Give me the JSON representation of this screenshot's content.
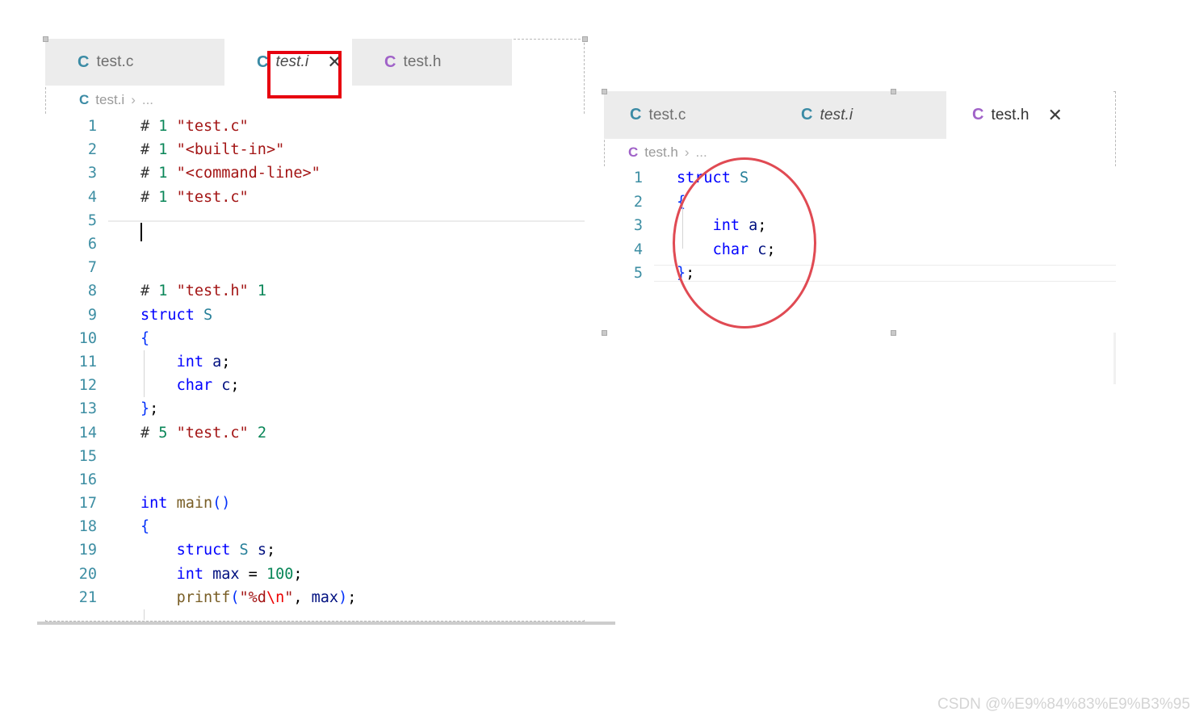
{
  "watermark": {
    "text": "CSDN @%E9%84%83%E9%B3%95"
  },
  "colors": {
    "annotation_red": "#e7000f",
    "annotation_ellipse": "#e04a53",
    "tab_active_bg": "#ffffff",
    "tab_inactive_bg": "#ececec",
    "gutter_number": "#3d8ea3",
    "c_icon_teal": "#3b8ba5",
    "c_icon_purple": "#a062c8"
  },
  "left_editor": {
    "tabs": [
      {
        "icon": "c-file-icon",
        "icon_color": "teal",
        "label": "test.c",
        "active": false,
        "italic": false,
        "closable": false
      },
      {
        "icon": "c-file-icon",
        "icon_color": "teal",
        "label": "test.i",
        "active": true,
        "italic": true,
        "closable": true,
        "close_label": "✕"
      },
      {
        "icon": "c-file-icon",
        "icon_color": "purple",
        "label": "test.h",
        "active": false,
        "italic": false,
        "closable": false
      }
    ],
    "breadcrumb": {
      "icon": "c-file-icon",
      "icon_color": "teal",
      "file": "test.i",
      "separator": "›",
      "tail": "..."
    },
    "active_line": 5,
    "lines": [
      {
        "n": "1",
        "tokens": [
          {
            "t": "# ",
            "c": "t-hash"
          },
          {
            "t": "1",
            "c": "t-num"
          },
          {
            "t": " ",
            "c": "t-plain"
          },
          {
            "t": "\"test.c\"",
            "c": "t-str"
          }
        ]
      },
      {
        "n": "2",
        "tokens": [
          {
            "t": "# ",
            "c": "t-hash"
          },
          {
            "t": "1",
            "c": "t-num"
          },
          {
            "t": " ",
            "c": "t-plain"
          },
          {
            "t": "\"<built-in>\"",
            "c": "t-str"
          }
        ]
      },
      {
        "n": "3",
        "tokens": [
          {
            "t": "# ",
            "c": "t-hash"
          },
          {
            "t": "1",
            "c": "t-num"
          },
          {
            "t": " ",
            "c": "t-plain"
          },
          {
            "t": "\"<command-line>\"",
            "c": "t-str"
          }
        ]
      },
      {
        "n": "4",
        "tokens": [
          {
            "t": "# ",
            "c": "t-hash"
          },
          {
            "t": "1",
            "c": "t-num"
          },
          {
            "t": " ",
            "c": "t-plain"
          },
          {
            "t": "\"test.c\"",
            "c": "t-str"
          }
        ]
      },
      {
        "n": "5",
        "tokens": []
      },
      {
        "n": "6",
        "tokens": []
      },
      {
        "n": "7",
        "tokens": []
      },
      {
        "n": "8",
        "tokens": [
          {
            "t": "# ",
            "c": "t-hash"
          },
          {
            "t": "1",
            "c": "t-num"
          },
          {
            "t": " ",
            "c": "t-plain"
          },
          {
            "t": "\"test.h\"",
            "c": "t-str"
          },
          {
            "t": " ",
            "c": "t-plain"
          },
          {
            "t": "1",
            "c": "t-num"
          }
        ]
      },
      {
        "n": "9",
        "tokens": [
          {
            "t": "struct",
            "c": "t-kw"
          },
          {
            "t": " ",
            "c": "t-plain"
          },
          {
            "t": "S",
            "c": "t-type"
          }
        ]
      },
      {
        "n": "10",
        "tokens": [
          {
            "t": "{",
            "c": "t-paren"
          }
        ]
      },
      {
        "n": "11",
        "tokens": [
          {
            "t": "    ",
            "c": "t-plain"
          },
          {
            "t": "int",
            "c": "t-kw"
          },
          {
            "t": " ",
            "c": "t-plain"
          },
          {
            "t": "a",
            "c": "t-ident"
          },
          {
            "t": ";",
            "c": "t-punct"
          }
        ]
      },
      {
        "n": "12",
        "tokens": [
          {
            "t": "    ",
            "c": "t-plain"
          },
          {
            "t": "char",
            "c": "t-kw"
          },
          {
            "t": " ",
            "c": "t-plain"
          },
          {
            "t": "c",
            "c": "t-ident"
          },
          {
            "t": ";",
            "c": "t-punct"
          }
        ]
      },
      {
        "n": "13",
        "tokens": [
          {
            "t": "}",
            "c": "t-paren"
          },
          {
            "t": ";",
            "c": "t-punct"
          }
        ]
      },
      {
        "n": "14",
        "tokens": [
          {
            "t": "# ",
            "c": "t-hash"
          },
          {
            "t": "5",
            "c": "t-num"
          },
          {
            "t": " ",
            "c": "t-plain"
          },
          {
            "t": "\"test.c\"",
            "c": "t-str"
          },
          {
            "t": " ",
            "c": "t-plain"
          },
          {
            "t": "2",
            "c": "t-num"
          }
        ]
      },
      {
        "n": "15",
        "tokens": []
      },
      {
        "n": "16",
        "tokens": []
      },
      {
        "n": "17",
        "tokens": [
          {
            "t": "int",
            "c": "t-kw"
          },
          {
            "t": " ",
            "c": "t-plain"
          },
          {
            "t": "main",
            "c": "t-fn"
          },
          {
            "t": "()",
            "c": "t-paren"
          }
        ]
      },
      {
        "n": "18",
        "tokens": [
          {
            "t": "{",
            "c": "t-paren"
          }
        ]
      },
      {
        "n": "19",
        "tokens": [
          {
            "t": "    ",
            "c": "t-plain"
          },
          {
            "t": "struct",
            "c": "t-kw"
          },
          {
            "t": " ",
            "c": "t-plain"
          },
          {
            "t": "S",
            "c": "t-type"
          },
          {
            "t": " ",
            "c": "t-plain"
          },
          {
            "t": "s",
            "c": "t-ident"
          },
          {
            "t": ";",
            "c": "t-punct"
          }
        ]
      },
      {
        "n": "20",
        "tokens": [
          {
            "t": "    ",
            "c": "t-plain"
          },
          {
            "t": "int",
            "c": "t-kw"
          },
          {
            "t": " ",
            "c": "t-plain"
          },
          {
            "t": "max",
            "c": "t-ident"
          },
          {
            "t": " = ",
            "c": "t-plain"
          },
          {
            "t": "100",
            "c": "t-num"
          },
          {
            "t": ";",
            "c": "t-punct"
          }
        ]
      },
      {
        "n": "21",
        "tokens": [
          {
            "t": "    ",
            "c": "t-plain"
          },
          {
            "t": "printf",
            "c": "t-fn"
          },
          {
            "t": "(",
            "c": "t-paren"
          },
          {
            "t": "\"%d",
            "c": "t-str"
          },
          {
            "t": "\\n",
            "c": "t-esc"
          },
          {
            "t": "\"",
            "c": "t-str"
          },
          {
            "t": ", ",
            "c": "t-plain"
          },
          {
            "t": "max",
            "c": "t-ident"
          },
          {
            "t": ")",
            "c": "t-paren"
          },
          {
            "t": ";",
            "c": "t-punct"
          }
        ]
      }
    ]
  },
  "right_editor": {
    "tabs": [
      {
        "icon": "c-file-icon",
        "icon_color": "teal",
        "label": "test.c",
        "active": false,
        "italic": false,
        "closable": false
      },
      {
        "icon": "c-file-icon",
        "icon_color": "teal",
        "label": "test.i",
        "active": false,
        "italic": true,
        "closable": false
      },
      {
        "icon": "c-file-icon",
        "icon_color": "purple",
        "label": "test.h",
        "active": true,
        "italic": false,
        "closable": true,
        "close_label": "✕"
      }
    ],
    "breadcrumb": {
      "icon": "c-file-icon",
      "icon_color": "purple",
      "file": "test.h",
      "separator": "›",
      "tail": "..."
    },
    "active_line": 5,
    "lines": [
      {
        "n": "1",
        "tokens": [
          {
            "t": "struct",
            "c": "t-kw"
          },
          {
            "t": " ",
            "c": "t-plain"
          },
          {
            "t": "S",
            "c": "t-type"
          }
        ]
      },
      {
        "n": "2",
        "tokens": [
          {
            "t": "{",
            "c": "t-paren"
          }
        ]
      },
      {
        "n": "3",
        "tokens": [
          {
            "t": "    ",
            "c": "t-plain"
          },
          {
            "t": "int",
            "c": "t-kw"
          },
          {
            "t": " ",
            "c": "t-plain"
          },
          {
            "t": "a",
            "c": "t-ident"
          },
          {
            "t": ";",
            "c": "t-punct"
          }
        ]
      },
      {
        "n": "4",
        "tokens": [
          {
            "t": "    ",
            "c": "t-plain"
          },
          {
            "t": "char",
            "c": "t-kw"
          },
          {
            "t": " ",
            "c": "t-plain"
          },
          {
            "t": "c",
            "c": "t-ident"
          },
          {
            "t": ";",
            "c": "t-punct"
          }
        ]
      },
      {
        "n": "5",
        "tokens": [
          {
            "t": "}",
            "c": "t-paren"
          },
          {
            "t": ";",
            "c": "t-punct"
          }
        ]
      }
    ]
  },
  "annotations": [
    {
      "name": "red-rect-around-test-i-tab",
      "shape": "rect"
    },
    {
      "name": "red-ellipse-around-struct-body",
      "shape": "ellipse"
    }
  ]
}
